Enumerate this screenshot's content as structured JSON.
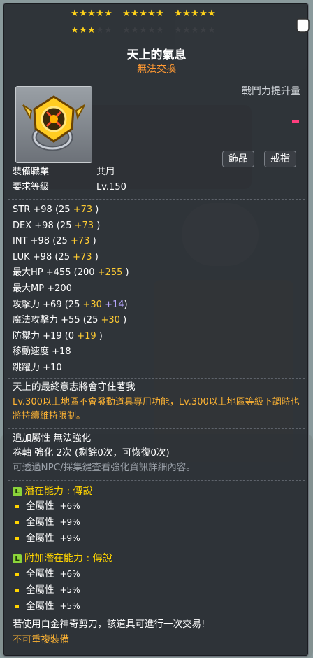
{
  "stars": {
    "filled": 18,
    "total": 30
  },
  "item": {
    "name": "天上的氣息",
    "trade_status": "無法交換"
  },
  "power_label": "戰鬥力提升量",
  "tags": [
    "飾品",
    "戒指"
  ],
  "job": {
    "label": "裝備職業",
    "value": "共用"
  },
  "req_level": {
    "label": "要求等級",
    "value": "Lv.150"
  },
  "stats": [
    {
      "label": "STR",
      "total": "+98",
      "base": "(25",
      "bonus1": "+73",
      "bonus2": "",
      "close": ")"
    },
    {
      "label": "DEX",
      "total": "+98",
      "base": "(25",
      "bonus1": "+73",
      "bonus2": "",
      "close": ")"
    },
    {
      "label": "INT",
      "total": "+98",
      "base": "(25",
      "bonus1": "+73",
      "bonus2": "",
      "close": ")"
    },
    {
      "label": "LUK",
      "total": "+98",
      "base": "(25",
      "bonus1": "+73",
      "bonus2": "",
      "close": ")"
    },
    {
      "label": "最大HP",
      "total": "+455",
      "base": "(200",
      "bonus1": "+255",
      "bonus2": "",
      "close": ")"
    },
    {
      "label": "最大MP",
      "total": "+200",
      "base": "",
      "bonus1": "",
      "bonus2": "",
      "close": ""
    },
    {
      "label": "攻擊力",
      "total": "+69",
      "base": "(25",
      "bonus1": "+30",
      "bonus2": "+14",
      "close": ")"
    },
    {
      "label": "魔法攻擊力",
      "total": "+55",
      "base": "(25",
      "bonus1": "+30",
      "bonus2": "",
      "close": ")"
    },
    {
      "label": "防禦力",
      "total": "+19",
      "base": "(0",
      "bonus1": "+19",
      "bonus2": "",
      "close": ")"
    },
    {
      "label": "移動速度",
      "total": "+18",
      "base": "",
      "bonus1": "",
      "bonus2": "",
      "close": ""
    },
    {
      "label": "跳躍力",
      "total": "+10",
      "base": "",
      "bonus1": "",
      "bonus2": "",
      "close": ""
    }
  ],
  "description": {
    "line1": "天上的最終意志將會守住著我",
    "line2": "Lv.300以上地區不會發動道具專用功能，Lv.300以上地區等級下調時也將持續維持限制。"
  },
  "enhance": {
    "line1": "追加屬性 無法強化",
    "line2": "卷軸 強化 2次 (剩餘0次，可恢復0次)",
    "line3": "可透過NPC/採集鍵查看強化資訊詳細內容。"
  },
  "potential": {
    "badge": "L",
    "title": "潛在能力 : 傳說",
    "lines": [
      {
        "label": "全屬性",
        "value": "+6%"
      },
      {
        "label": "全屬性",
        "value": "+9%"
      },
      {
        "label": "全屬性",
        "value": "+9%"
      }
    ]
  },
  "additional_potential": {
    "badge": "L",
    "title": "附加潛在能力 : 傳說",
    "lines": [
      {
        "label": "全屬性",
        "value": "+6%"
      },
      {
        "label": "全屬性",
        "value": "+5%"
      },
      {
        "label": "全屬性",
        "value": "+5%"
      }
    ]
  },
  "footer": {
    "scissors": "若使用白金神奇剪刀，該道具可進行一次交易!",
    "unique": "不可重複裝備"
  },
  "colors": {
    "star_on": "#ffd21a",
    "star_off": "#3c3f44",
    "bonus": "#ffcc33",
    "extra": "#b8a8ff",
    "legend": "#8bd43a",
    "trade": "#ff9933"
  }
}
